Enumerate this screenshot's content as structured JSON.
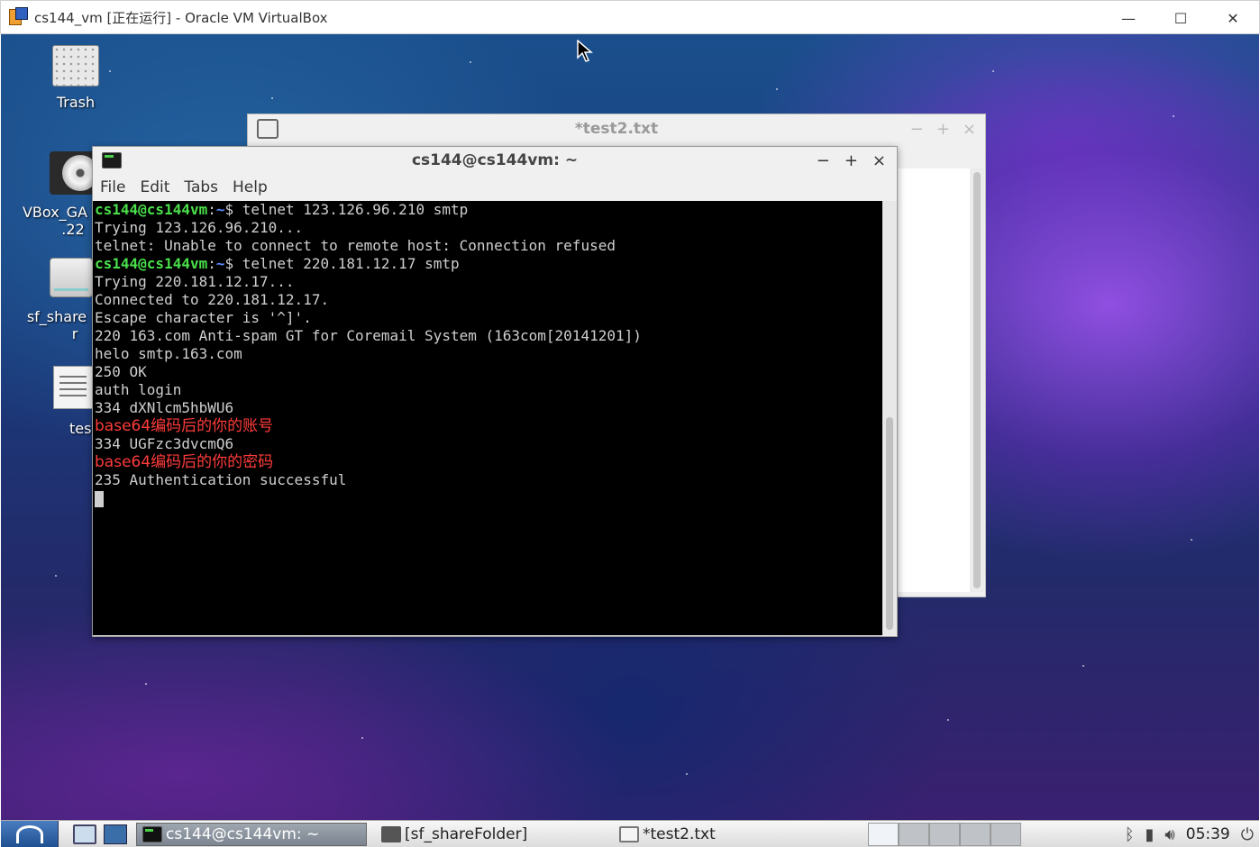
{
  "host": {
    "title": "cs144_vm [正在运行] - Oracle VM VirtualBox",
    "minimize": "—",
    "maximize": "☐",
    "close": "✕"
  },
  "desktop": {
    "icons": [
      {
        "label": "Trash",
        "icon": "trash-icon"
      },
      {
        "label": "VBox_GA",
        "label2": ".22",
        "icon": "cdrom-icon"
      },
      {
        "label": "sf_share",
        "label2": "r",
        "icon": "drive-icon"
      },
      {
        "label": "test",
        "icon": "document-icon"
      }
    ]
  },
  "editor": {
    "title": "*test2.txt",
    "minimize": "−",
    "maximize": "+",
    "close": "×"
  },
  "terminal": {
    "title": "cs144@cs144vm: ~",
    "minimize": "−",
    "maximize": "+",
    "close": "×",
    "menu": [
      "File",
      "Edit",
      "Tabs",
      "Help"
    ],
    "prompt_user": "cs144@cs144vm",
    "prompt_sep": ":",
    "prompt_path": "~",
    "prompt_dollar": "$",
    "lines": [
      {
        "kind": "prompt",
        "cmd": " telnet 123.126.96.210 smtp"
      },
      {
        "kind": "text",
        "text": "Trying 123.126.96.210..."
      },
      {
        "kind": "text",
        "text": "telnet: Unable to connect to remote host: Connection refused"
      },
      {
        "kind": "prompt",
        "cmd": " telnet 220.181.12.17 smtp"
      },
      {
        "kind": "text",
        "text": "Trying 220.181.12.17..."
      },
      {
        "kind": "text",
        "text": "Connected to 220.181.12.17."
      },
      {
        "kind": "text",
        "text": "Escape character is '^]'."
      },
      {
        "kind": "text",
        "text": "220 163.com Anti-spam GT for Coremail System (163com[20141201])"
      },
      {
        "kind": "text",
        "text": "helo smtp.163.com"
      },
      {
        "kind": "text",
        "text": "250 OK"
      },
      {
        "kind": "text",
        "text": "auth login"
      },
      {
        "kind": "text",
        "text": "334 dXNlcm5hbWU6"
      },
      {
        "kind": "note",
        "text": "base64编码后的你的账号"
      },
      {
        "kind": "text",
        "text": "334 UGFzc3dvcmQ6"
      },
      {
        "kind": "note",
        "text": "base64编码后的你的密码"
      },
      {
        "kind": "text",
        "text": "235 Authentication successful"
      },
      {
        "kind": "cursor",
        "text": ""
      }
    ]
  },
  "taskbar": {
    "tasks": [
      {
        "label": "cs144@cs144vm: ~",
        "icon": "terminal-icon",
        "active": true
      },
      {
        "label": "[sf_shareFolder]",
        "icon": "folder-icon",
        "active": false
      },
      {
        "label": "*test2.txt",
        "icon": "notepad-icon",
        "active": false
      }
    ],
    "clock": "05:39"
  }
}
